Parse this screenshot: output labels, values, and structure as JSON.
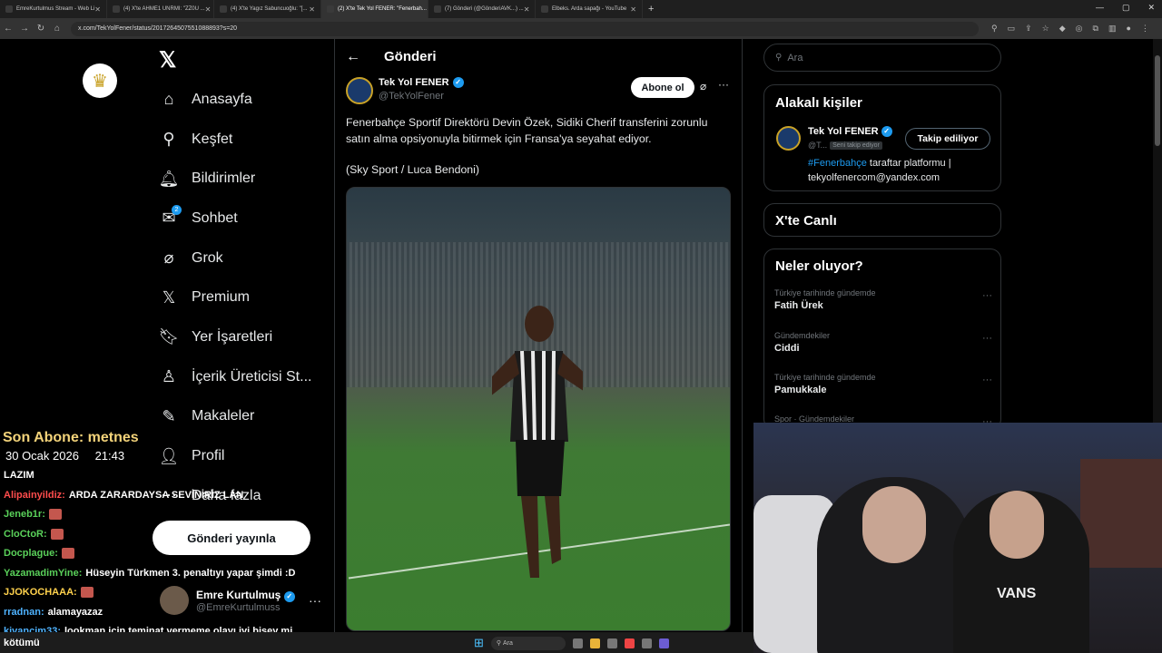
{
  "browser": {
    "tabs": [
      {
        "label": "EmreKurtulmus Stream - Web Li",
        "icon": "kick-icon"
      },
      {
        "label": "(4) X'te AHME1 UNRMI: \"ZZ0U ...",
        "icon": "x-icon"
      },
      {
        "label": "(4) X'te Yagız Sabuncuoğlu: \"[...",
        "icon": "x-icon"
      },
      {
        "label": "(2) X'te Tek Yol FENER: \"Fenerbah...",
        "icon": "x-icon"
      },
      {
        "label": "(7) Gönderi (@GönderiAVK...) ...",
        "icon": "x-icon"
      },
      {
        "label": "Elbeks. Arda sapağı - YouTube",
        "icon": "youtube-icon"
      }
    ],
    "active_tab": 3,
    "new_tab": "+",
    "window_controls": [
      "—",
      "▢",
      "✕"
    ],
    "url": "x.com/TekYolFener/status/2017264507551088893?s=20"
  },
  "site_logo": "crown-logo",
  "nav": {
    "items": [
      {
        "label": "Anasayfa",
        "icon": "home-icon",
        "glyph": "⌂"
      },
      {
        "label": "Keşfet",
        "icon": "search-icon",
        "glyph": "⚲"
      },
      {
        "label": "Bildirimler",
        "icon": "bell-icon",
        "glyph": "🔔︎"
      },
      {
        "label": "Sohbet",
        "icon": "mail-icon",
        "glyph": "✉",
        "badge": "2"
      },
      {
        "label": "Grok",
        "icon": "grok-icon",
        "glyph": "⌀"
      },
      {
        "label": "Premium",
        "icon": "x-premium-icon",
        "glyph": "𝕏"
      },
      {
        "label": "Yer İşaretleri",
        "icon": "bookmark-icon",
        "glyph": "🔖︎"
      },
      {
        "label": "İçerik Üreticisi St...",
        "icon": "creator-icon",
        "glyph": "♙"
      },
      {
        "label": "Makaleler",
        "icon": "article-icon",
        "glyph": "✎"
      },
      {
        "label": "Profil",
        "icon": "profile-icon",
        "glyph": "👤︎"
      },
      {
        "label": "Daha fazla",
        "icon": "more-circle-icon",
        "glyph": "⋯"
      }
    ],
    "post_button": "Gönderi yayınla",
    "account": {
      "name": "Emre Kurtulmuş",
      "handle": "@EmreKurtulmuss",
      "more": "···"
    }
  },
  "post": {
    "header": "Gönderi",
    "back": "←",
    "author": {
      "name": "Tek Yol FENER",
      "handle": "@TekYolFener",
      "verified": "✓"
    },
    "subscribe": "Abone ol",
    "more": "···",
    "text": "Fenerbahçe Sportif Direktörü Devin Özek, Sidiki Cherif transferini zorunlu satın alma opsiyonuyla bitirmek için Fransa'ya seyahat ediyor.",
    "source": "(Sky Sport / Luca Bendoni)",
    "image_alt": "football-player-celebrating-photo"
  },
  "sidebar": {
    "search_placeholder": "Ara",
    "related": {
      "title": "Alakalı kişiler",
      "person": {
        "name": "Tek Yol FENER",
        "handle": "@T...",
        "follows_you": "Seni takip ediyor",
        "follow_button": "Takip ediliyor",
        "bio_tag": "#Fenerbahçe",
        "bio_rest": " taraftar platformu | tekyolfenercom@yandex.com"
      }
    },
    "live": {
      "title": "X'te Canlı"
    },
    "trends": {
      "title": "Neler oluyor?",
      "items": [
        {
          "context": "Türkiye tarihinde gündemde",
          "name": "Fatih Ürek"
        },
        {
          "context": "Gündemdekiler",
          "name": "Ciddi"
        },
        {
          "context": "Türkiye tarihinde gündemde",
          "name": "Pamukkale"
        },
        {
          "context": "Spor · Gündemdekiler",
          "name": ""
        }
      ]
    }
  },
  "overlay": {
    "last_sub": "Son Abone: metnes",
    "date": "30 Ocak 2026",
    "time": "21:43",
    "chat": [
      {
        "user": "LAZIM",
        "color": "#ffffff",
        "text": "",
        "emote": false
      },
      {
        "user": "Alipainyildiz:",
        "color": "#ff4d4d",
        "text": "ARDA ZARARDAYSA SEVİNİRİZ LAN",
        "emote": false
      },
      {
        "user": "Jeneb1r:",
        "color": "#5ad15a",
        "text": "",
        "emote": true
      },
      {
        "user": "CloCtoR:",
        "color": "#5ad15a",
        "text": "",
        "emote": true
      },
      {
        "user": "Docplague:",
        "color": "#5ad15a",
        "text": "",
        "emote": true
      },
      {
        "user": "YazamadimYine:",
        "color": "#5ad15a",
        "text": "Hüseyin Türkmen 3. penaltıyı yapar şimdi :D",
        "emote": false
      },
      {
        "user": "JJOKOCHAAA:",
        "color": "#ffd24d",
        "text": "",
        "emote": true
      },
      {
        "user": "rradnan:",
        "color": "#4fb3ff",
        "text": "alamayazaz",
        "emote": false
      },
      {
        "user": "kivancim33:",
        "color": "#4fb3ff",
        "text": "lookman icin teminat vermeme olayı iyi bişey mi",
        "emote": false
      }
    ],
    "taskbar_chat": "kötümü",
    "taskbar_search": "Ara"
  },
  "colors": {
    "accent": "#1d9bf0",
    "background": "#000000",
    "border": "#2f3336",
    "sub_gold": "#f3d37a"
  }
}
